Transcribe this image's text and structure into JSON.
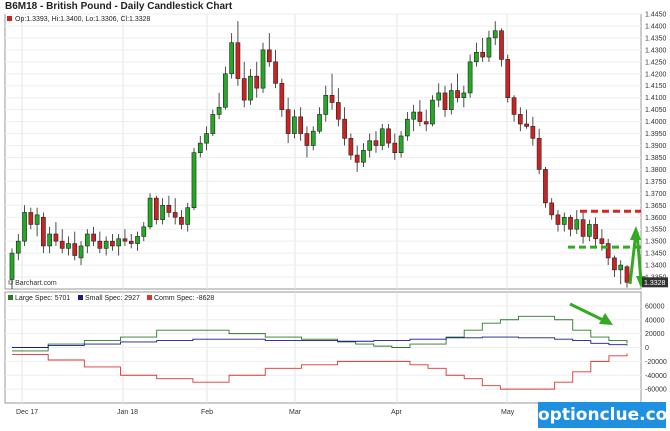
{
  "title": "B6M18 - British Pound - Daily Candlestick Chart",
  "ohlc_readout": "Op:1.3393, Hi:1.3400, Lo:1.3306, Cl:1.3328",
  "last_price_label": "1.3328",
  "source_label": "© Barchart.com",
  "brand": "optionclue.com",
  "colors": {
    "up": "#22aa22",
    "down": "#cc2222",
    "large": "#2a7a2a",
    "small": "#1a1a8c",
    "comm": "#dd3333",
    "annotation_red": "#dd2222",
    "annotation_green": "#33aa22"
  },
  "chart_data": [
    {
      "type": "candlestick",
      "title": "B6M18 - British Pound - Daily Candlestick Chart",
      "ylim": [
        1.33,
        1.445
      ],
      "y_ticks": [
        "1.4450",
        "1.4400",
        "1.4350",
        "1.4300",
        "1.4250",
        "1.4200",
        "1.4150",
        "1.4100",
        "1.4050",
        "1.4000",
        "1.3950",
        "1.3900",
        "1.3850",
        "1.3800",
        "1.3750",
        "1.3700",
        "1.3650",
        "1.3600",
        "1.3550",
        "1.3500",
        "1.3450",
        "1.3400",
        "1.3350"
      ],
      "x_ticks": [
        "Dec 17",
        "Jan 18",
        "Feb",
        "Mar",
        "Apr",
        "May"
      ],
      "candles": [
        {
          "o": 1.334,
          "h": 1.347,
          "l": 1.33,
          "c": 1.345
        },
        {
          "o": 1.345,
          "h": 1.353,
          "l": 1.342,
          "c": 1.35
        },
        {
          "o": 1.35,
          "h": 1.365,
          "l": 1.348,
          "c": 1.362
        },
        {
          "o": 1.362,
          "h": 1.364,
          "l": 1.355,
          "c": 1.357
        },
        {
          "o": 1.357,
          "h": 1.364,
          "l": 1.352,
          "c": 1.361
        },
        {
          "o": 1.36,
          "h": 1.362,
          "l": 1.345,
          "c": 1.348
        },
        {
          "o": 1.348,
          "h": 1.356,
          "l": 1.345,
          "c": 1.353
        },
        {
          "o": 1.353,
          "h": 1.358,
          "l": 1.348,
          "c": 1.35
        },
        {
          "o": 1.35,
          "h": 1.355,
          "l": 1.345,
          "c": 1.347
        },
        {
          "o": 1.347,
          "h": 1.352,
          "l": 1.344,
          "c": 1.349
        },
        {
          "o": 1.349,
          "h": 1.354,
          "l": 1.342,
          "c": 1.344
        },
        {
          "o": 1.343,
          "h": 1.35,
          "l": 1.34,
          "c": 1.348
        },
        {
          "o": 1.348,
          "h": 1.355,
          "l": 1.345,
          "c": 1.353
        },
        {
          "o": 1.353,
          "h": 1.356,
          "l": 1.348,
          "c": 1.35
        },
        {
          "o": 1.35,
          "h": 1.354,
          "l": 1.345,
          "c": 1.347
        },
        {
          "o": 1.347,
          "h": 1.352,
          "l": 1.344,
          "c": 1.35
        },
        {
          "o": 1.35,
          "h": 1.353,
          "l": 1.346,
          "c": 1.348
        },
        {
          "o": 1.348,
          "h": 1.353,
          "l": 1.344,
          "c": 1.351
        },
        {
          "o": 1.351,
          "h": 1.355,
          "l": 1.348,
          "c": 1.35
        },
        {
          "o": 1.35,
          "h": 1.353,
          "l": 1.347,
          "c": 1.349
        },
        {
          "o": 1.349,
          "h": 1.354,
          "l": 1.346,
          "c": 1.352
        },
        {
          "o": 1.352,
          "h": 1.358,
          "l": 1.35,
          "c": 1.356
        },
        {
          "o": 1.356,
          "h": 1.37,
          "l": 1.355,
          "c": 1.368
        },
        {
          "o": 1.368,
          "h": 1.369,
          "l": 1.357,
          "c": 1.359
        },
        {
          "o": 1.359,
          "h": 1.368,
          "l": 1.357,
          "c": 1.365
        },
        {
          "o": 1.365,
          "h": 1.369,
          "l": 1.36,
          "c": 1.362
        },
        {
          "o": 1.362,
          "h": 1.368,
          "l": 1.357,
          "c": 1.36
        },
        {
          "o": 1.36,
          "h": 1.363,
          "l": 1.355,
          "c": 1.357
        },
        {
          "o": 1.357,
          "h": 1.366,
          "l": 1.354,
          "c": 1.364
        },
        {
          "o": 1.364,
          "h": 1.389,
          "l": 1.363,
          "c": 1.387
        },
        {
          "o": 1.387,
          "h": 1.394,
          "l": 1.385,
          "c": 1.391
        },
        {
          "o": 1.391,
          "h": 1.398,
          "l": 1.388,
          "c": 1.395
        },
        {
          "o": 1.395,
          "h": 1.405,
          "l": 1.394,
          "c": 1.403
        },
        {
          "o": 1.403,
          "h": 1.412,
          "l": 1.401,
          "c": 1.406
        },
        {
          "o": 1.406,
          "h": 1.423,
          "l": 1.405,
          "c": 1.42
        },
        {
          "o": 1.42,
          "h": 1.437,
          "l": 1.418,
          "c": 1.433
        },
        {
          "o": 1.433,
          "h": 1.442,
          "l": 1.415,
          "c": 1.418
        },
        {
          "o": 1.418,
          "h": 1.425,
          "l": 1.406,
          "c": 1.409
        },
        {
          "o": 1.409,
          "h": 1.422,
          "l": 1.407,
          "c": 1.419
        },
        {
          "o": 1.419,
          "h": 1.425,
          "l": 1.41,
          "c": 1.414
        },
        {
          "o": 1.414,
          "h": 1.433,
          "l": 1.412,
          "c": 1.43
        },
        {
          "o": 1.43,
          "h": 1.437,
          "l": 1.423,
          "c": 1.425
        },
        {
          "o": 1.425,
          "h": 1.43,
          "l": 1.414,
          "c": 1.416
        },
        {
          "o": 1.416,
          "h": 1.418,
          "l": 1.402,
          "c": 1.405
        },
        {
          "o": 1.405,
          "h": 1.41,
          "l": 1.391,
          "c": 1.395
        },
        {
          "o": 1.395,
          "h": 1.405,
          "l": 1.393,
          "c": 1.402
        },
        {
          "o": 1.402,
          "h": 1.406,
          "l": 1.392,
          "c": 1.395
        },
        {
          "o": 1.395,
          "h": 1.398,
          "l": 1.385,
          "c": 1.39
        },
        {
          "o": 1.39,
          "h": 1.398,
          "l": 1.388,
          "c": 1.396
        },
        {
          "o": 1.396,
          "h": 1.406,
          "l": 1.395,
          "c": 1.403
        },
        {
          "o": 1.403,
          "h": 1.415,
          "l": 1.4,
          "c": 1.411
        },
        {
          "o": 1.411,
          "h": 1.42,
          "l": 1.405,
          "c": 1.408
        },
        {
          "o": 1.408,
          "h": 1.414,
          "l": 1.398,
          "c": 1.401
        },
        {
          "o": 1.401,
          "h": 1.406,
          "l": 1.39,
          "c": 1.393
        },
        {
          "o": 1.393,
          "h": 1.395,
          "l": 1.384,
          "c": 1.386
        },
        {
          "o": 1.386,
          "h": 1.39,
          "l": 1.379,
          "c": 1.383
        },
        {
          "o": 1.383,
          "h": 1.391,
          "l": 1.381,
          "c": 1.388
        },
        {
          "o": 1.388,
          "h": 1.395,
          "l": 1.385,
          "c": 1.392
        },
        {
          "o": 1.392,
          "h": 1.396,
          "l": 1.387,
          "c": 1.39
        },
        {
          "o": 1.39,
          "h": 1.399,
          "l": 1.388,
          "c": 1.397
        },
        {
          "o": 1.397,
          "h": 1.399,
          "l": 1.389,
          "c": 1.391
        },
        {
          "o": 1.391,
          "h": 1.395,
          "l": 1.384,
          "c": 1.387
        },
        {
          "o": 1.387,
          "h": 1.396,
          "l": 1.385,
          "c": 1.394
        },
        {
          "o": 1.394,
          "h": 1.404,
          "l": 1.392,
          "c": 1.401
        },
        {
          "o": 1.401,
          "h": 1.407,
          "l": 1.396,
          "c": 1.404
        },
        {
          "o": 1.404,
          "h": 1.409,
          "l": 1.398,
          "c": 1.4
        },
        {
          "o": 1.4,
          "h": 1.405,
          "l": 1.396,
          "c": 1.399
        },
        {
          "o": 1.399,
          "h": 1.411,
          "l": 1.398,
          "c": 1.409
        },
        {
          "o": 1.409,
          "h": 1.416,
          "l": 1.406,
          "c": 1.412
        },
        {
          "o": 1.412,
          "h": 1.415,
          "l": 1.402,
          "c": 1.405
        },
        {
          "o": 1.405,
          "h": 1.416,
          "l": 1.403,
          "c": 1.413
        },
        {
          "o": 1.413,
          "h": 1.42,
          "l": 1.408,
          "c": 1.41
        },
        {
          "o": 1.41,
          "h": 1.415,
          "l": 1.406,
          "c": 1.412
        },
        {
          "o": 1.412,
          "h": 1.428,
          "l": 1.41,
          "c": 1.425
        },
        {
          "o": 1.425,
          "h": 1.433,
          "l": 1.423,
          "c": 1.429
        },
        {
          "o": 1.429,
          "h": 1.435,
          "l": 1.425,
          "c": 1.427
        },
        {
          "o": 1.427,
          "h": 1.438,
          "l": 1.425,
          "c": 1.435
        },
        {
          "o": 1.435,
          "h": 1.442,
          "l": 1.432,
          "c": 1.438
        },
        {
          "o": 1.438,
          "h": 1.439,
          "l": 1.423,
          "c": 1.426
        },
        {
          "o": 1.426,
          "h": 1.428,
          "l": 1.408,
          "c": 1.41
        },
        {
          "o": 1.41,
          "h": 1.411,
          "l": 1.4,
          "c": 1.403
        },
        {
          "o": 1.403,
          "h": 1.406,
          "l": 1.396,
          "c": 1.399
        },
        {
          "o": 1.399,
          "h": 1.405,
          "l": 1.397,
          "c": 1.398
        },
        {
          "o": 1.398,
          "h": 1.402,
          "l": 1.39,
          "c": 1.393
        },
        {
          "o": 1.393,
          "h": 1.397,
          "l": 1.378,
          "c": 1.38
        },
        {
          "o": 1.38,
          "h": 1.381,
          "l": 1.364,
          "c": 1.366
        },
        {
          "o": 1.366,
          "h": 1.368,
          "l": 1.359,
          "c": 1.361
        },
        {
          "o": 1.361,
          "h": 1.363,
          "l": 1.354,
          "c": 1.357
        },
        {
          "o": 1.357,
          "h": 1.362,
          "l": 1.354,
          "c": 1.36
        },
        {
          "o": 1.36,
          "h": 1.361,
          "l": 1.352,
          "c": 1.355
        },
        {
          "o": 1.355,
          "h": 1.363,
          "l": 1.353,
          "c": 1.359
        },
        {
          "o": 1.359,
          "h": 1.362,
          "l": 1.349,
          "c": 1.352
        },
        {
          "o": 1.352,
          "h": 1.359,
          "l": 1.35,
          "c": 1.357
        },
        {
          "o": 1.357,
          "h": 1.36,
          "l": 1.348,
          "c": 1.351
        },
        {
          "o": 1.351,
          "h": 1.355,
          "l": 1.346,
          "c": 1.349
        },
        {
          "o": 1.349,
          "h": 1.351,
          "l": 1.34,
          "c": 1.343
        },
        {
          "o": 1.343,
          "h": 1.344,
          "l": 1.335,
          "c": 1.338
        },
        {
          "o": 1.338,
          "h": 1.342,
          "l": 1.332,
          "c": 1.34
        },
        {
          "o": 1.3393,
          "h": 1.34,
          "l": 1.3306,
          "c": 1.3328
        }
      ],
      "annotations": {
        "resistance_level": 1.3625,
        "support_level": 1.3475
      }
    },
    {
      "type": "line",
      "title": "",
      "ylim": [
        -80000,
        80000
      ],
      "y_ticks": [
        "60000",
        "40000",
        "20000",
        "0",
        "-20000",
        "-40000",
        "-60000"
      ],
      "series": [
        {
          "name": "Large Spec",
          "legend": "Large Spec: 5701",
          "values": [
            -5000,
            -5000,
            5000,
            5000,
            10000,
            10000,
            15000,
            15000,
            25000,
            25000,
            25000,
            25000,
            20000,
            20000,
            15000,
            15000,
            12000,
            12000,
            8000,
            5000,
            2000,
            0,
            5000,
            5000,
            15000,
            25000,
            35000,
            40000,
            45000,
            45000,
            40000,
            25000,
            15000,
            10000,
            5701
          ]
        },
        {
          "name": "Small Spec",
          "legend": "Small Spec: 2927",
          "values": [
            0,
            0,
            3000,
            3000,
            5000,
            5000,
            8000,
            8000,
            10000,
            10000,
            12000,
            12000,
            12000,
            12000,
            10000,
            10000,
            10000,
            10000,
            9000,
            9000,
            10000,
            10000,
            12000,
            12000,
            14000,
            14000,
            15000,
            15000,
            14000,
            14000,
            12000,
            10000,
            6000,
            4000,
            2927
          ]
        },
        {
          "name": "Comm Spec",
          "legend": "Comm Spec: -8628",
          "values": [
            -10000,
            -10000,
            -18000,
            -18000,
            -28000,
            -28000,
            -40000,
            -40000,
            -45000,
            -45000,
            -50000,
            -50000,
            -40000,
            -40000,
            -30000,
            -30000,
            -25000,
            -25000,
            -20000,
            -20000,
            -20000,
            -20000,
            -25000,
            -30000,
            -40000,
            -45000,
            -55000,
            -60000,
            -60000,
            -60000,
            -50000,
            -35000,
            -20000,
            -12000,
            -8628
          ]
        }
      ]
    }
  ]
}
